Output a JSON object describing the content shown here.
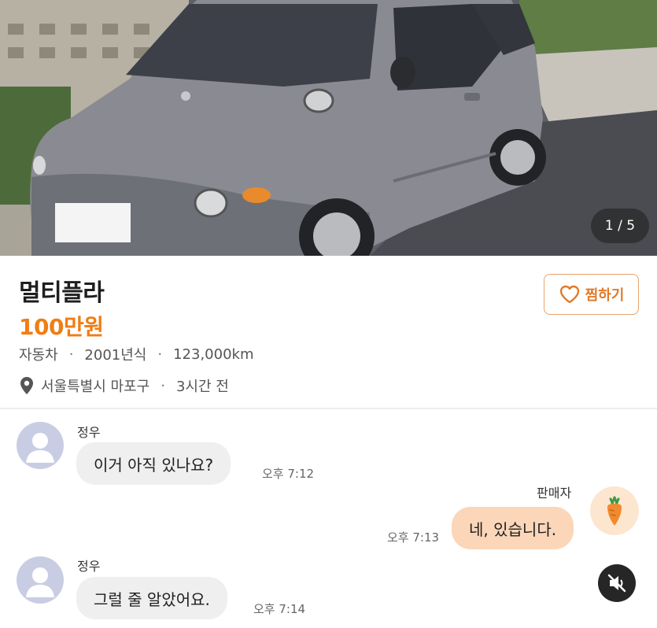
{
  "photo": {
    "counter": "1 / 5"
  },
  "listing": {
    "title": "멀티플라",
    "price": "100만원",
    "category": "자동차",
    "separator": "·",
    "year": "2001년식",
    "mileage": "123,000km",
    "location": "서울특별시 마포구",
    "posted": "3시간 전",
    "like_label": "찜하기",
    "accent_color": "#f07d14"
  },
  "chat": {
    "messages": [
      {
        "sender": "정우",
        "text": "이거 아직 있나요?",
        "time": "오후 7:12"
      },
      {
        "sender": "판매자",
        "text": "네, 있습니다.",
        "time": "오후 7:13"
      },
      {
        "sender": "정우",
        "text": "그럴 줄 알았어요.",
        "time": "오후 7:14"
      }
    ]
  },
  "icons": {
    "pin": "map-pin-icon",
    "heart": "heart-outline-icon",
    "avatar": "default-user-avatar-icon",
    "seller": "carrot-icon",
    "mute": "speaker-muted-icon"
  }
}
